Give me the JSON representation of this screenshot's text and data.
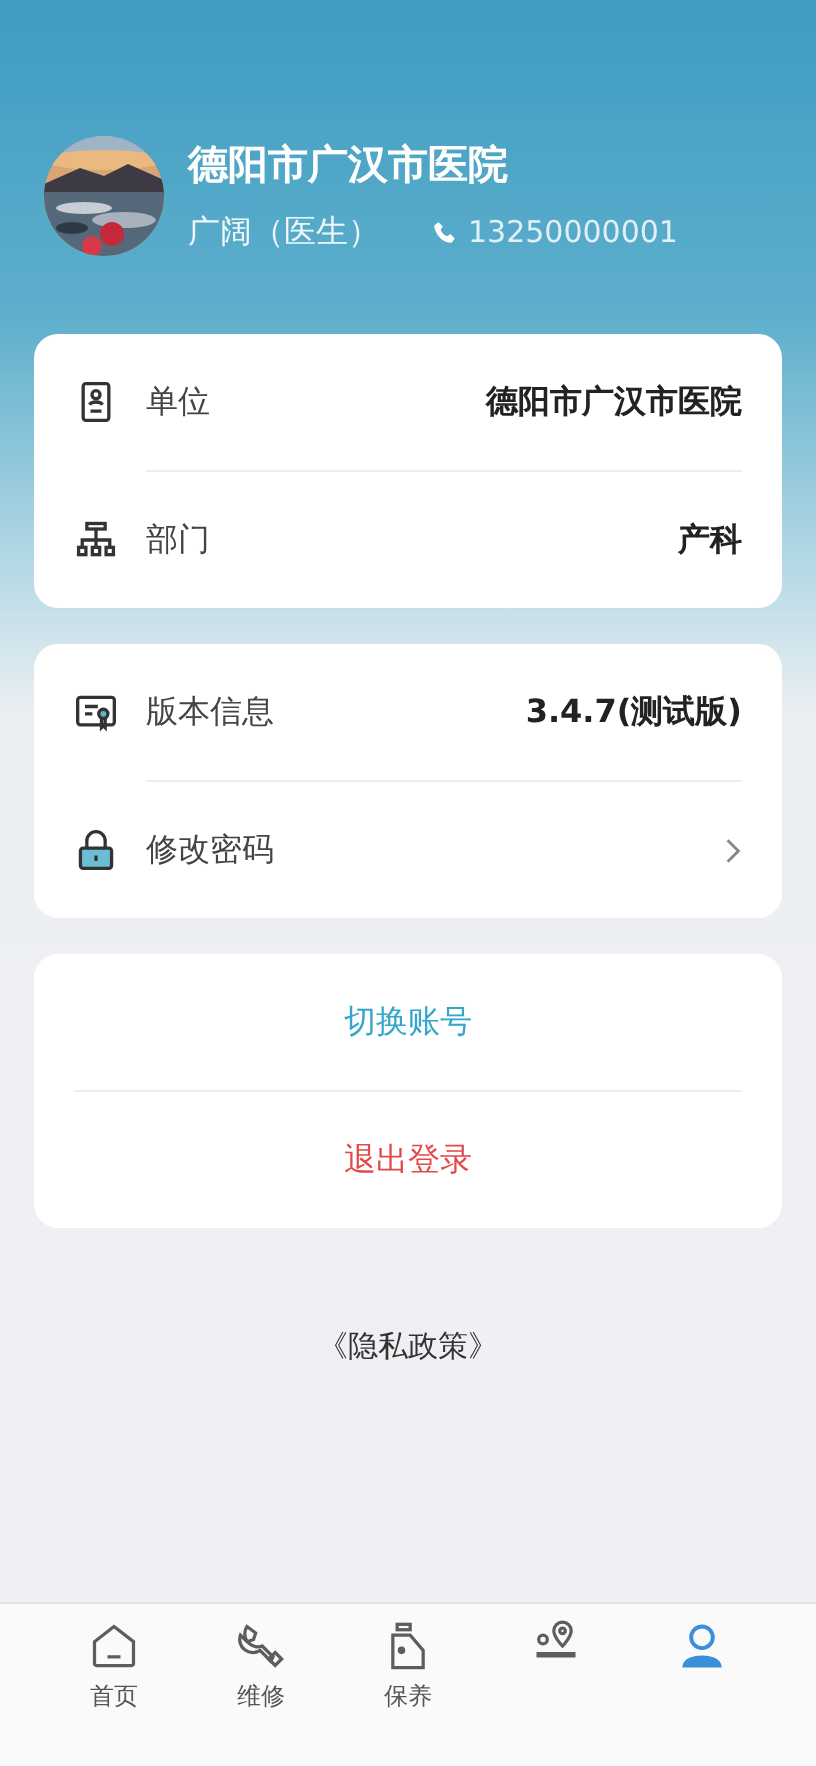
{
  "profile": {
    "name": "德阳市广汉市医院",
    "user": "广阔（医生）",
    "phone": "13250000001"
  },
  "info_card": [
    {
      "label": "单位",
      "value": "德阳市广汉市医院"
    },
    {
      "label": "部门",
      "value": "产科"
    }
  ],
  "settings_card": [
    {
      "label": "版本信息",
      "value": "3.4.7(测试版)",
      "kind": "value"
    },
    {
      "label": "修改密码",
      "kind": "link"
    }
  ],
  "account_actions": [
    {
      "label": "切换账号",
      "kind": "switch"
    },
    {
      "label": "退出登录",
      "kind": "logout"
    }
  ],
  "privacy_link": "《隐私政策》",
  "tab_bar": [
    {
      "label": "首页",
      "selected": false
    },
    {
      "label": "维修",
      "selected": false
    },
    {
      "label": "保养",
      "selected": false
    },
    {
      "selected": false
    },
    {
      "selected": true
    }
  ]
}
